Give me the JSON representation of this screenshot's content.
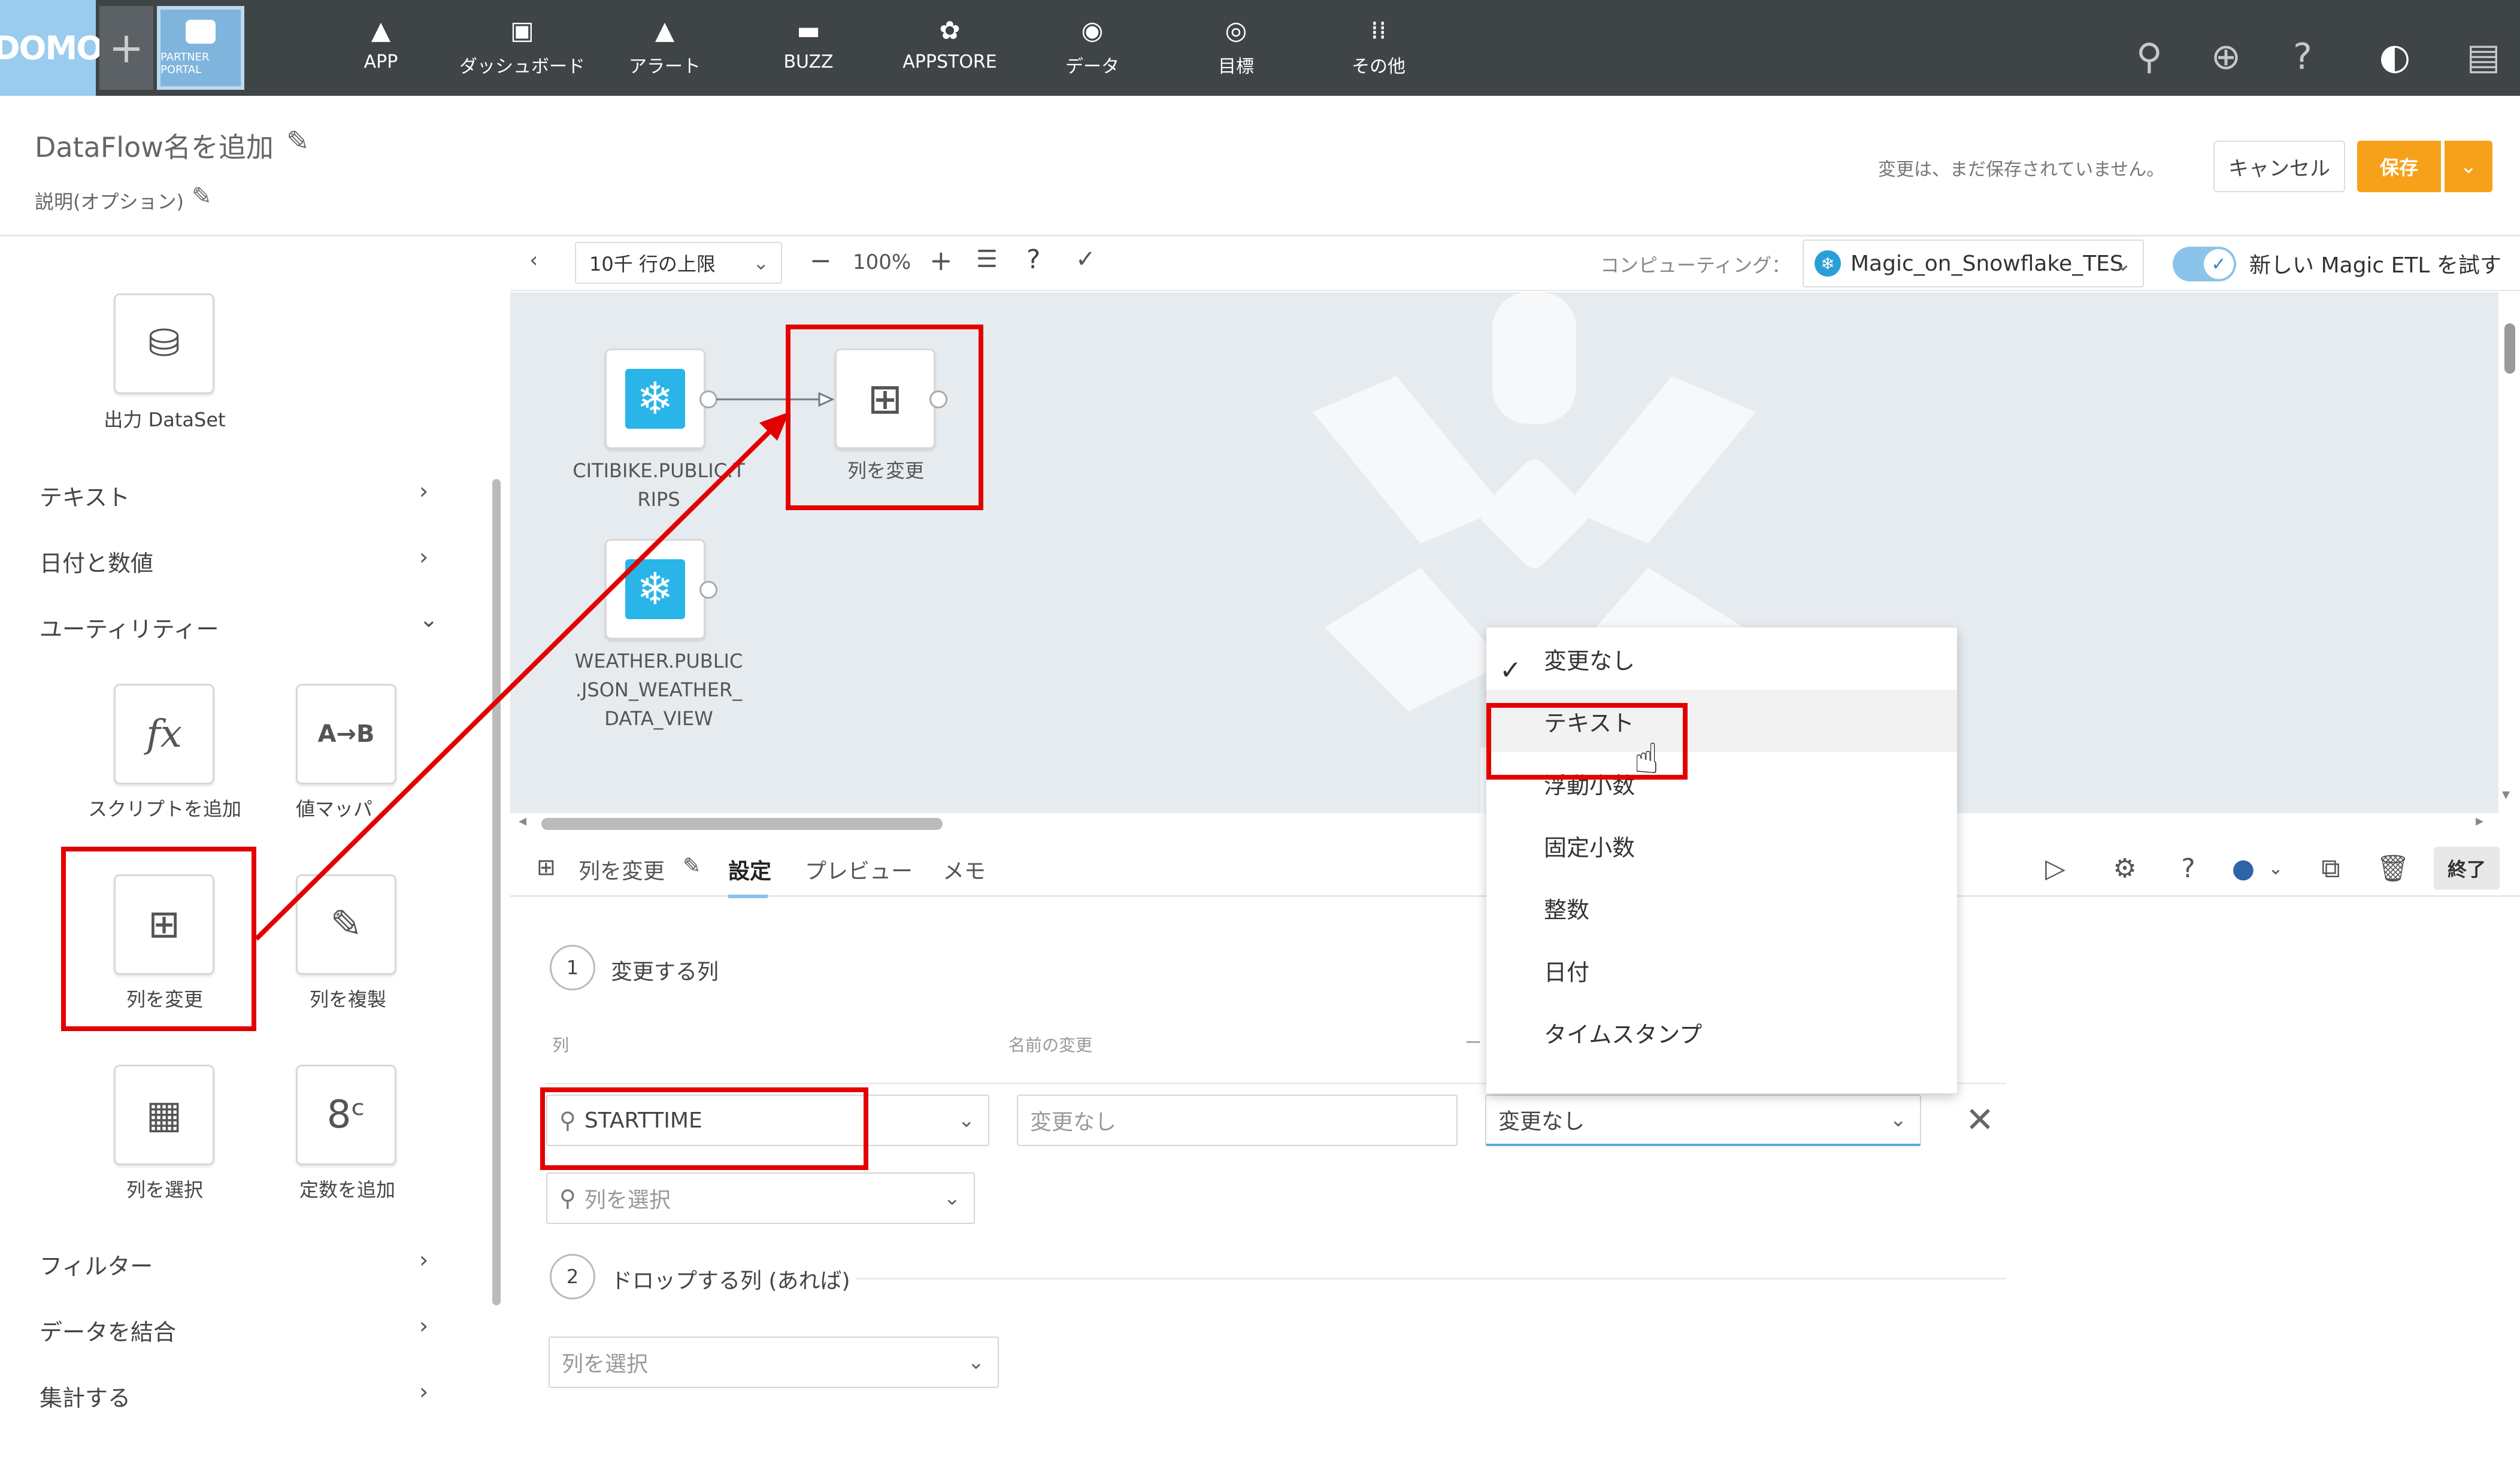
{
  "topnav": {
    "logo": "DOMO",
    "portal_label": "PARTNER PORTAL",
    "items": [
      {
        "label": "APP",
        "icon": "app-icon"
      },
      {
        "label": "ダッシュボード",
        "icon": "dashboard-icon"
      },
      {
        "label": "アラート",
        "icon": "bell-icon"
      },
      {
        "label": "BUZZ",
        "icon": "chat-icon"
      },
      {
        "label": "APPSTORE",
        "icon": "appstore-icon"
      },
      {
        "label": "データ",
        "icon": "database-icon"
      },
      {
        "label": "目標",
        "icon": "target-icon"
      },
      {
        "label": "その他",
        "icon": "grid-icon"
      }
    ]
  },
  "header": {
    "title": "DataFlow名を追加",
    "description": "説明(オプション)",
    "unsaved": "変更は、まだ保存されていません。",
    "cancel": "キャンセル",
    "save": "保存"
  },
  "left_panel": {
    "output_tile": "出力 DataSet",
    "categories": {
      "text": "テキスト",
      "date_number": "日付と数値",
      "utility": "ユーティリティー",
      "filter": "フィルター",
      "join": "データを結合",
      "aggregate": "集計する"
    },
    "tiles": {
      "script": "スクリプトを追加",
      "value_map": "値マッパ",
      "alter_columns": "列を変更",
      "duplicate": "列を複製",
      "select": "列を選択",
      "add_constant": "定数を追加"
    },
    "icon_text": {
      "fx": "fx",
      "ab": "A→B"
    }
  },
  "canvas_toolbar": {
    "row_limit": "10千 行の上限",
    "zoom": "100%",
    "compute_label": "コンピューティング：",
    "compute_value": "Magic_on_Snowflake_TES",
    "try_new": "新しい Magic ETL を試す"
  },
  "canvas": {
    "nodes": [
      {
        "label": "CITIBIKE.PUBLIC.T\nRIPS"
      },
      {
        "label": "WEATHER.PUBLIC\n.JSON_WEATHER_\nDATA_VIEW"
      },
      {
        "label": "列を変更"
      }
    ]
  },
  "bottom_panel": {
    "tile_name": "列を変更",
    "tabs": [
      "設定",
      "プレビュー",
      "メモ"
    ],
    "finish": "終了",
    "step1": {
      "num": "1",
      "label": "変更する列"
    },
    "col_headers": {
      "column": "列",
      "rename": "名前の変更",
      "type": "ー"
    },
    "row": {
      "column": "STARTTIME",
      "rename_placeholder": "変更なし",
      "type_value": "変更なし"
    },
    "select_placeholder": "列を選択",
    "step2": {
      "num": "2",
      "label": "ドロップする列 (あれば)"
    },
    "drop_placeholder": "列を選択"
  },
  "type_menu": {
    "items": [
      "変更なし",
      "テキスト",
      "浮動小数",
      "固定小数",
      "整数",
      "日付",
      "タイムスタンプ"
    ],
    "selected_index": 0,
    "hover_index": 1
  },
  "colors": {
    "nav_bg": "#3f4446",
    "accent_orange": "#f7a11a",
    "highlight_red": "#e30000",
    "snowflake_blue": "#29b5e8"
  }
}
